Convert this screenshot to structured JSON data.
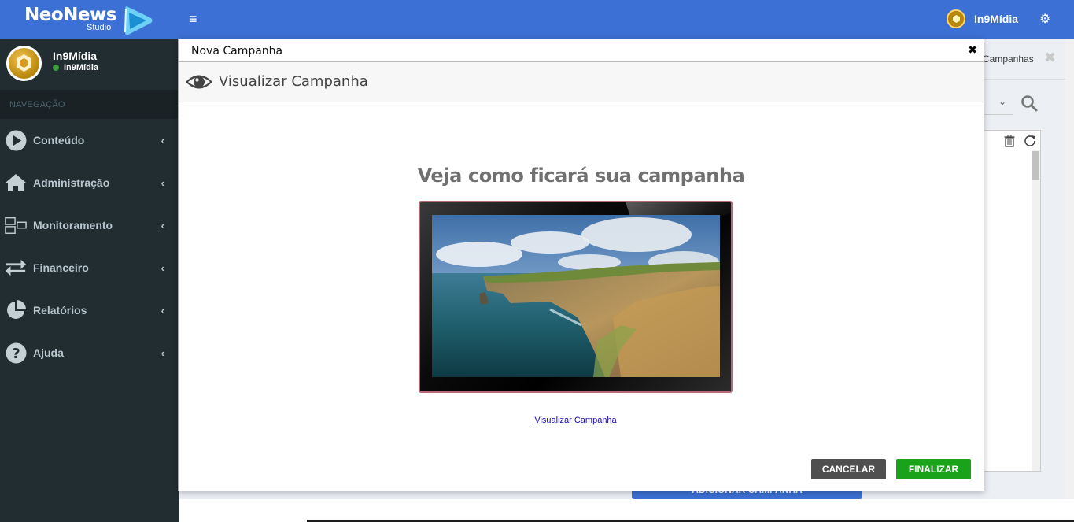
{
  "brand": {
    "name": "NeoNews",
    "sub": "Studio"
  },
  "topbar": {
    "user_name": "In9Mídia"
  },
  "sidebar": {
    "user_name": "In9Mídia",
    "user_status": "In9Mídia",
    "nav_header": "NAVEGAÇÃO",
    "items": [
      {
        "label": "Conteúdo",
        "icon": "play-circle-icon"
      },
      {
        "label": "Administração",
        "icon": "home-icon"
      },
      {
        "label": "Monitoramento",
        "icon": "monitor-icon"
      },
      {
        "label": "Financeiro",
        "icon": "exchange-icon"
      },
      {
        "label": "Relatórios",
        "icon": "pie-chart-icon"
      },
      {
        "label": "Ajuda",
        "icon": "question-circle-icon"
      }
    ]
  },
  "background": {
    "tab_label": "Campanhas",
    "add_button": "ADICIONAR CAMPANHA"
  },
  "modal": {
    "title": "Nova Campanha",
    "step_title": "Visualizar Campanha",
    "heading": "Veja como ficará sua campanha",
    "preview_link": "Visualizar Campanha",
    "cancel_label": "CANCELAR",
    "finish_label": "FINALIZAR"
  },
  "colors": {
    "topbar": "#3c70d4",
    "sidebar": "#222d32",
    "cancel": "#4f4f4f",
    "finish": "#1aa31a"
  }
}
